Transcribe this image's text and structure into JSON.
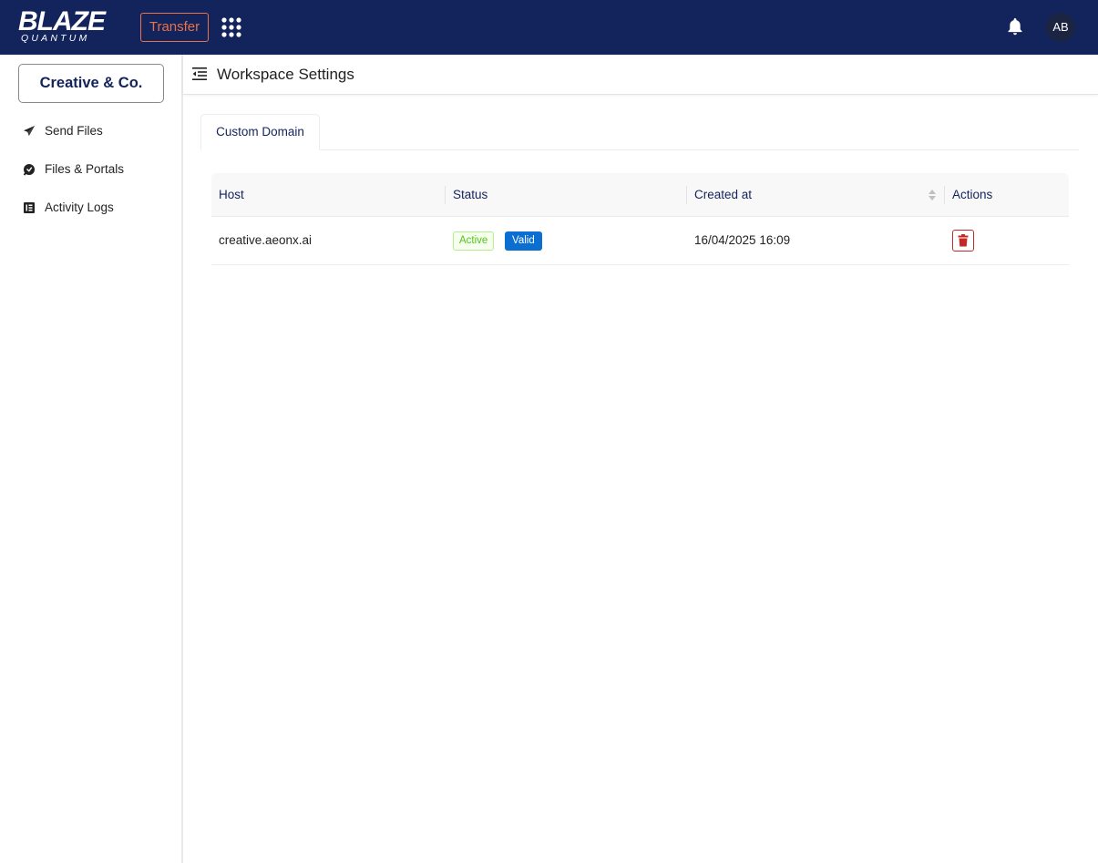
{
  "brand": {
    "name": "BLAZE",
    "sub": "QUANTUM"
  },
  "topbar": {
    "transfer_label": "Transfer",
    "apps_icon": "grid-apps-icon",
    "bell_icon": "bell-icon",
    "avatar_initials": "AB",
    "colors": {
      "bar": "#13235b",
      "accent": "#e8734a"
    }
  },
  "sidebar": {
    "workspace_label": "Creative & Co.",
    "items": [
      {
        "label": "Send Files",
        "icon": "paper-plane-icon"
      },
      {
        "label": "Files & Portals",
        "icon": "portal-icon"
      },
      {
        "label": "Activity Logs",
        "icon": "logs-icon"
      }
    ]
  },
  "header": {
    "title": "Workspace Settings",
    "menu_icon": "indent-menu-icon"
  },
  "tabs": [
    {
      "label": "Custom Domain",
      "active": true
    }
  ],
  "table": {
    "columns": [
      "Host",
      "Status",
      "Created at",
      "Actions"
    ],
    "rows": [
      {
        "host": "creative.aeonx.ai",
        "status": [
          "Active",
          "Valid"
        ],
        "created_at": "16/04/2025 16:09",
        "action_icon": "trash-icon"
      }
    ]
  },
  "colors": {
    "active_badge": "#52c41a",
    "valid_badge": "#0a6fd0",
    "delete": "#c62828"
  }
}
